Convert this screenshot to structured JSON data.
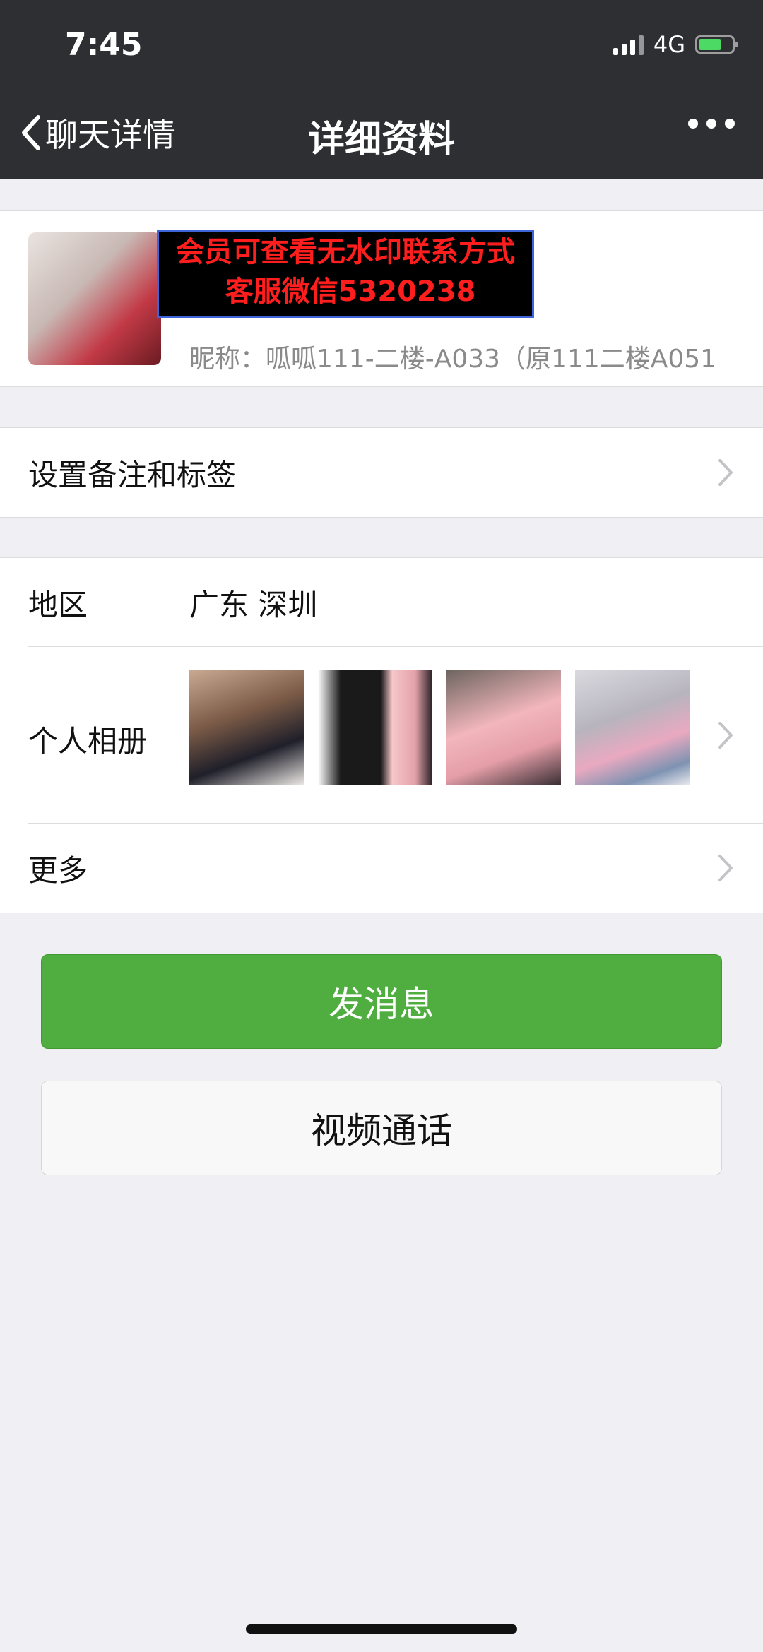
{
  "status_bar": {
    "time": "7:45",
    "network": "4G",
    "battery_level": 0.7
  },
  "nav": {
    "back_label": "聊天详情",
    "title": "详细资料"
  },
  "profile": {
    "overlay_line1": "会员可查看无水印联系方式",
    "overlay_line2": "客服微信5320238",
    "nickname": "昵称：呱呱111-二楼-A033（原111二楼A051"
  },
  "remark": {
    "label": "设置备注和标签"
  },
  "info": {
    "region_label": "地区",
    "region_value": "广东 深圳",
    "album_label": "个人相册",
    "more_label": "更多"
  },
  "actions": {
    "send_message": "发消息",
    "video_call": "视频通话"
  },
  "colors": {
    "topbar": "#2e2f33",
    "accent_green": "#4fae3f",
    "watermark_red": "#ff1e1e"
  }
}
